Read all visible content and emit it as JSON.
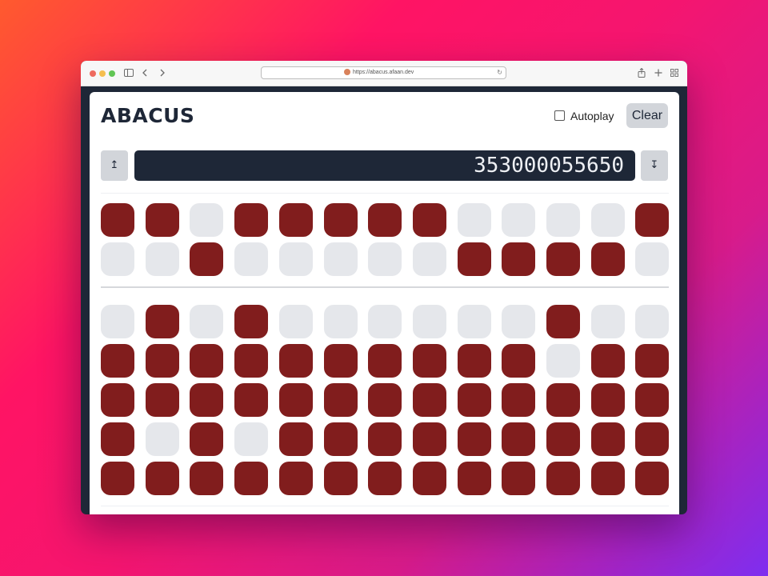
{
  "browser": {
    "url": "https://abacus.afaan.dev",
    "icons": {
      "sidebar": "sidebar-icon",
      "back": "chevron-left-icon",
      "forward": "chevron-right-icon",
      "site": "site-favicon-icon",
      "reload": "reload-icon",
      "share": "share-icon",
      "new_tab": "plus-icon",
      "tabs": "tab-overview-icon"
    }
  },
  "app": {
    "title": "ABACUS",
    "autoplay_label": "Autoplay",
    "autoplay_checked": false,
    "clear_label": "Clear",
    "shift_up_label": "↥",
    "shift_down_label": "↧",
    "display_value": "353000055650"
  },
  "colors": {
    "bead_on": "#811d1d",
    "bead_off": "#e5e7eb",
    "display_bg": "#1e2737",
    "button_bg": "#d2d5da"
  },
  "abacus": {
    "columns": 13,
    "upper_rows": [
      [
        1,
        1,
        0,
        1,
        1,
        1,
        1,
        1,
        0,
        0,
        0,
        0,
        1
      ],
      [
        0,
        0,
        1,
        0,
        0,
        0,
        0,
        0,
        1,
        1,
        1,
        1,
        0
      ]
    ],
    "lower_rows": [
      [
        0,
        1,
        0,
        1,
        0,
        0,
        0,
        0,
        0,
        0,
        1,
        0,
        0
      ],
      [
        1,
        1,
        1,
        1,
        1,
        1,
        1,
        1,
        1,
        1,
        0,
        1,
        1
      ],
      [
        1,
        1,
        1,
        1,
        1,
        1,
        1,
        1,
        1,
        1,
        1,
        1,
        1
      ],
      [
        1,
        0,
        1,
        0,
        1,
        1,
        1,
        1,
        1,
        1,
        1,
        1,
        1
      ],
      [
        1,
        1,
        1,
        1,
        1,
        1,
        1,
        1,
        1,
        1,
        1,
        1,
        1
      ]
    ]
  }
}
